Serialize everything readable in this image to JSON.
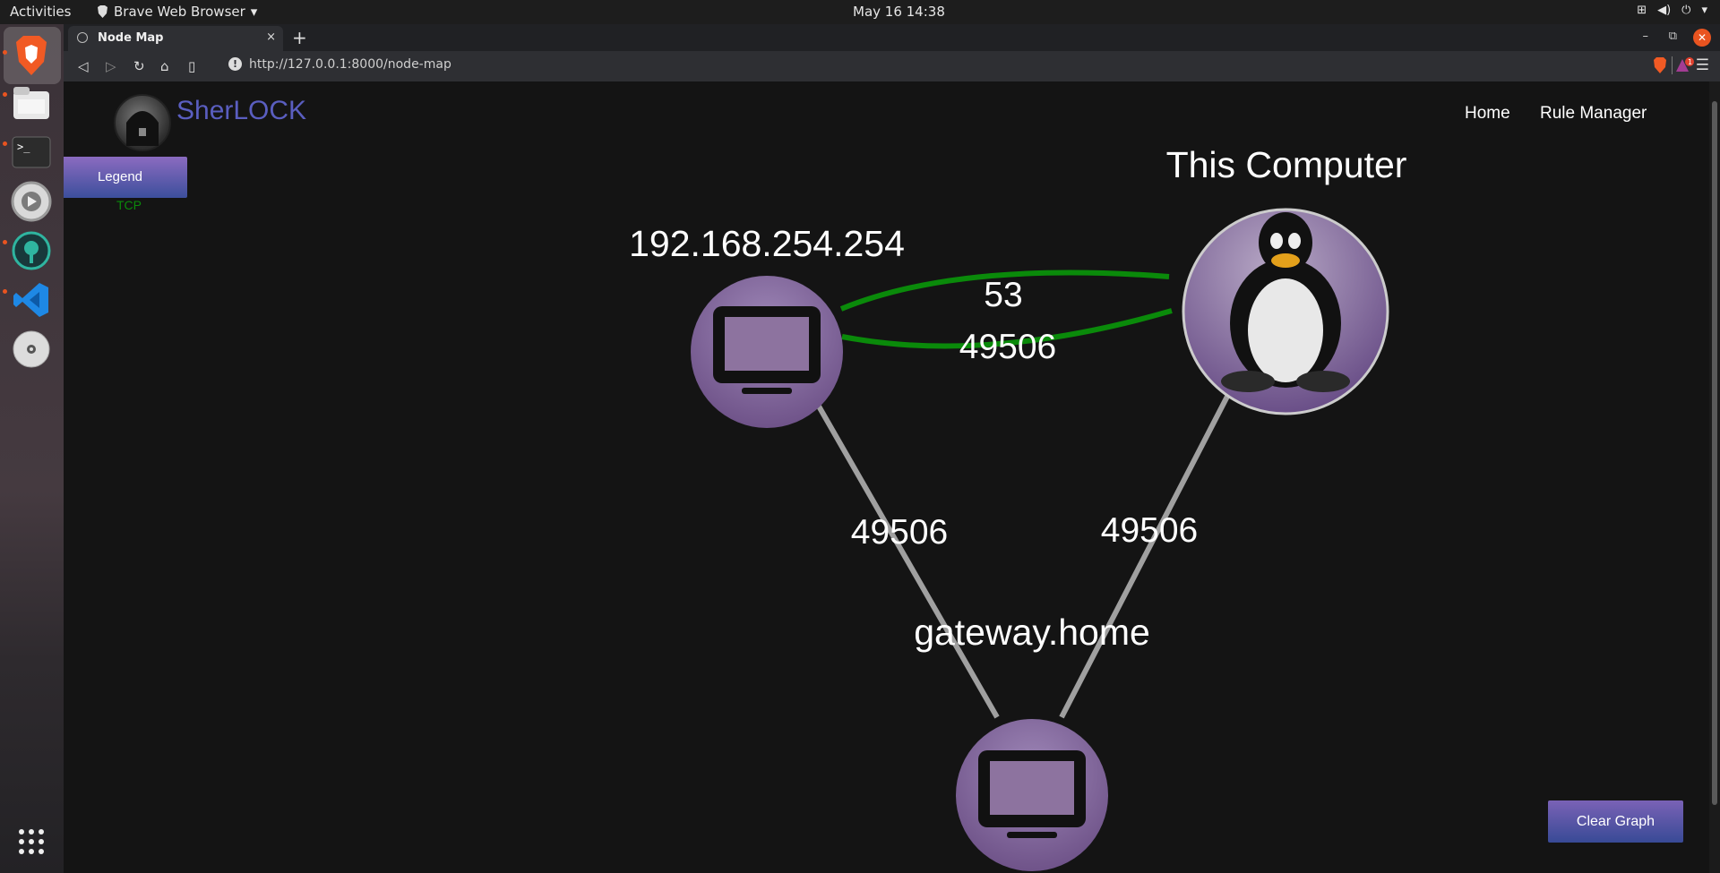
{
  "system": {
    "activities": "Activities",
    "app_name": "Brave Web Browser",
    "clock": "May 16  14:38"
  },
  "browser": {
    "tab_title": "Node Map",
    "tab_close": "×",
    "new_tab": "+",
    "url": "http://127.0.0.1:8000/node-map",
    "notification_count": "1"
  },
  "site": {
    "brand": "SherLOCK",
    "nav": [
      "Home",
      "Rule Manager"
    ],
    "legend_button": "Legend",
    "legend_items": [
      {
        "label": "TCP",
        "color": "#0a8a0a"
      }
    ],
    "clear_button": "Clear Graph"
  },
  "graph": {
    "nodes": [
      {
        "id": "n1",
        "label": "192.168.254.254",
        "icon": "monitor-icon"
      },
      {
        "id": "n2",
        "label": "This Computer",
        "icon": "linux-tux-icon"
      },
      {
        "id": "n3",
        "label": "gateway.home",
        "icon": "monitor-icon"
      }
    ],
    "edges": [
      {
        "from": "n1",
        "to": "n2",
        "label": "53",
        "protocol": "TCP",
        "color": "#0a8a0a"
      },
      {
        "from": "n1",
        "to": "n2",
        "label": "49506",
        "protocol": "TCP",
        "color": "#0a8a0a"
      },
      {
        "from": "n1",
        "to": "n3",
        "label": "49506",
        "color": "#a0a0a0"
      },
      {
        "from": "n2",
        "to": "n3",
        "label": "49506",
        "color": "#a0a0a0"
      }
    ]
  },
  "colors": {
    "accent": "#5a5ec0",
    "node_fill": "#8f72ab",
    "background": "#141414"
  }
}
